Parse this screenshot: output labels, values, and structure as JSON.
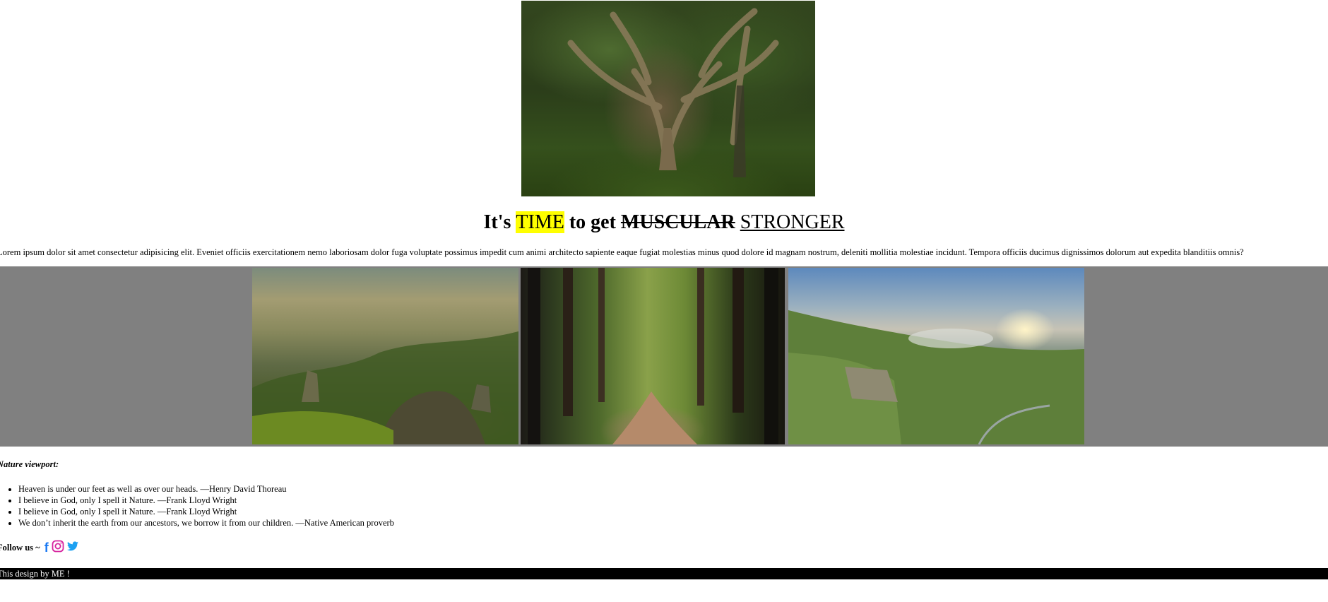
{
  "hero": {
    "image": "large-tree-forest-photo"
  },
  "headline": {
    "part1": "It's ",
    "highlight": "TIME",
    "part2": " to get ",
    "struck": "MUSCULAR",
    "space": " ",
    "underlined": "STRONGER"
  },
  "intro": "Lorem ipsum dolor sit amet consectetur adipisicing elit. Eveniet officiis exercitationem nemo laboriosam dolor fuga voluptate possimus impedit cum animi architecto sapiente eaque fugiat molestias minus quod dolore id magnam nostrum, deleniti mollitia molestiae incidunt. Tempora officiis ducimus dignissimos dolorum aut expedita blanditiis omnis?",
  "gallery": {
    "background": "#808080",
    "images": [
      "mountain-valley-photo",
      "forest-path-photo",
      "green-cliffs-sunset-photo"
    ]
  },
  "caption": "Nature viewport:",
  "quotes": [
    "Heaven is under our feet as well as over our heads. —Henry David Thoreau",
    "I believe in God, only I spell it Nature. —Frank Lloyd Wright",
    "I believe in God, only I spell it Nature. —Frank Lloyd Wright",
    "We don’t inherit the earth from our ancestors, we borrow it from our children. —Native American proverb"
  ],
  "follow": {
    "label": "Follow us ~ ",
    "facebook_glyph": "f",
    "icons": [
      "facebook-icon",
      "instagram-icon",
      "twitter-icon"
    ],
    "colors": {
      "facebook": "#1877f2",
      "instagram": "#d6249f",
      "twitter": "#1da1f2"
    }
  },
  "footer": "This design by ME !",
  "highlight_color": "#ffff00"
}
